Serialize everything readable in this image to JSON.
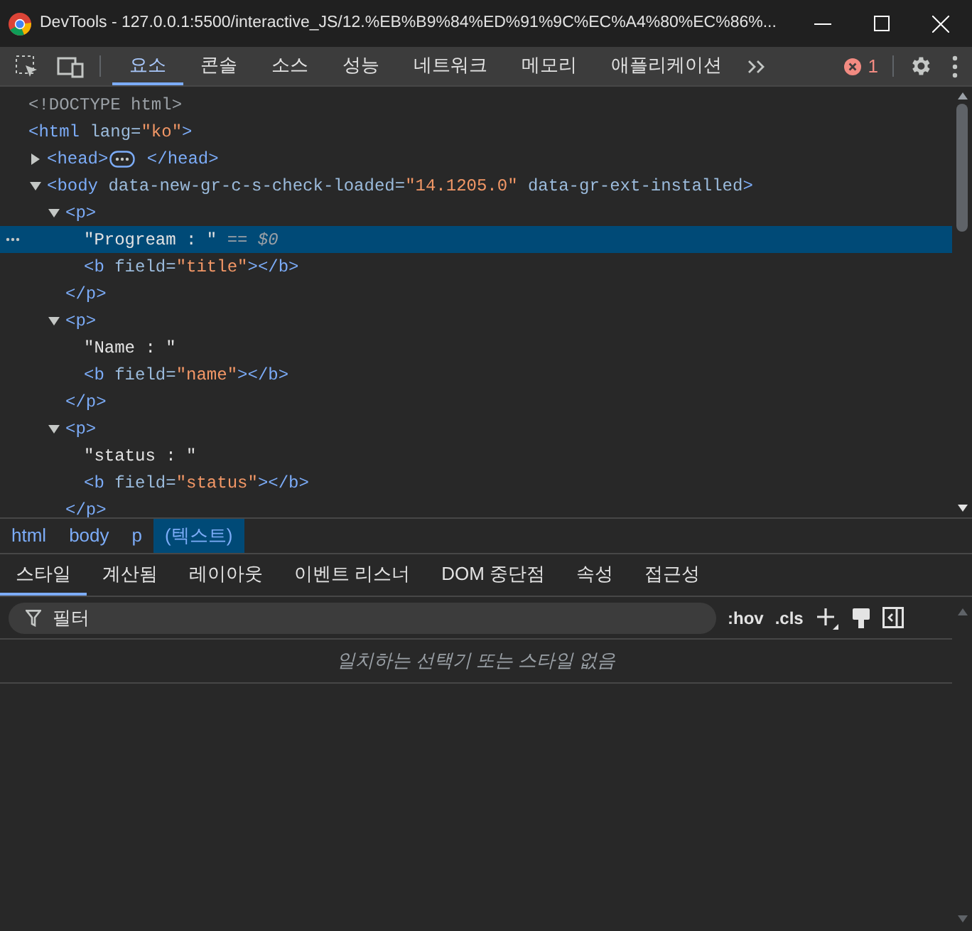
{
  "window": {
    "title": "DevTools - 127.0.0.1:5500/interactive_JS/12.%EB%B9%84%ED%91%9C%EC%A4%80%EC%86%..."
  },
  "tabs": [
    {
      "label": "요소",
      "selected": true
    },
    {
      "label": "콘솔",
      "selected": false
    },
    {
      "label": "소스",
      "selected": false
    },
    {
      "label": "성능",
      "selected": false
    },
    {
      "label": "네트워크",
      "selected": false
    },
    {
      "label": "메모리",
      "selected": false
    },
    {
      "label": "애플리케이션",
      "selected": false
    }
  ],
  "error_count": "1",
  "dom_tree": [
    {
      "tokens": [
        {
          "kind": "doctype",
          "text": "<!DOCTYPE html>"
        }
      ]
    },
    {
      "tokens": [
        {
          "kind": "tag",
          "text": "<html"
        },
        {
          "kind": "attr",
          "text": " lang="
        },
        {
          "kind": "value",
          "text": "\"ko\""
        },
        {
          "kind": "tag",
          "text": ">"
        }
      ],
      "children": [
        {
          "expanded": false,
          "tokens": [
            {
              "kind": "tag",
              "text": "<head>"
            },
            {
              "kind": "ellipsis"
            },
            {
              "kind": "tag",
              "text": " </head>"
            }
          ]
        },
        {
          "expanded": true,
          "tokens": [
            {
              "kind": "tag",
              "text": "<body"
            },
            {
              "kind": "attr",
              "text": " data-new-gr-c-s-check-loaded="
            },
            {
              "kind": "value",
              "text": "\"14.1205.0\""
            },
            {
              "kind": "attr",
              "text": " data-gr-ext-installed"
            },
            {
              "kind": "tag",
              "text": ">"
            }
          ],
          "children": [
            {
              "expanded": true,
              "tokens": [
                {
                  "kind": "tag",
                  "text": "<p>"
                }
              ],
              "close": "</p>",
              "children": [
                {
                  "selected": true,
                  "tokens": [
                    {
                      "kind": "text",
                      "text": "\"Progream : \""
                    },
                    {
                      "kind": "ref",
                      "text": " == $0"
                    }
                  ]
                },
                {
                  "tokens": [
                    {
                      "kind": "tag",
                      "text": "<b"
                    },
                    {
                      "kind": "attr",
                      "text": " field="
                    },
                    {
                      "kind": "value",
                      "text": "\"title\""
                    },
                    {
                      "kind": "tag",
                      "text": "></b>"
                    }
                  ]
                }
              ]
            },
            {
              "expanded": true,
              "tokens": [
                {
                  "kind": "tag",
                  "text": "<p>"
                }
              ],
              "close": "</p>",
              "children": [
                {
                  "tokens": [
                    {
                      "kind": "text",
                      "text": "\"Name : \""
                    }
                  ]
                },
                {
                  "tokens": [
                    {
                      "kind": "tag",
                      "text": "<b"
                    },
                    {
                      "kind": "attr",
                      "text": " field="
                    },
                    {
                      "kind": "value",
                      "text": "\"name\""
                    },
                    {
                      "kind": "tag",
                      "text": "></b>"
                    }
                  ]
                }
              ]
            },
            {
              "expanded": true,
              "tokens": [
                {
                  "kind": "tag",
                  "text": "<p>"
                }
              ],
              "close": "</p>",
              "children": [
                {
                  "tokens": [
                    {
                      "kind": "text",
                      "text": "\"status : \""
                    }
                  ]
                },
                {
                  "tokens": [
                    {
                      "kind": "tag",
                      "text": "<b"
                    },
                    {
                      "kind": "attr",
                      "text": " field="
                    },
                    {
                      "kind": "value",
                      "text": "\"status\""
                    },
                    {
                      "kind": "tag",
                      "text": "></b>"
                    }
                  ]
                }
              ]
            }
          ]
        }
      ]
    }
  ],
  "breadcrumbs": [
    {
      "label": "html",
      "selected": false
    },
    {
      "label": "body",
      "selected": false
    },
    {
      "label": "p",
      "selected": false
    },
    {
      "label": "(텍스트)",
      "selected": true
    }
  ],
  "style_tabs": [
    {
      "label": "스타일",
      "selected": true
    },
    {
      "label": "계산됨",
      "selected": false
    },
    {
      "label": "레이아웃",
      "selected": false
    },
    {
      "label": "이벤트 리스너",
      "selected": false
    },
    {
      "label": "DOM 중단점",
      "selected": false
    },
    {
      "label": "속성",
      "selected": false
    },
    {
      "label": "접근성",
      "selected": false
    }
  ],
  "filter": {
    "placeholder": "필터"
  },
  "style_buttons": [
    ":hov",
    ".cls"
  ],
  "empty_message": "일치하는 선택기 또는 스타일 없음"
}
